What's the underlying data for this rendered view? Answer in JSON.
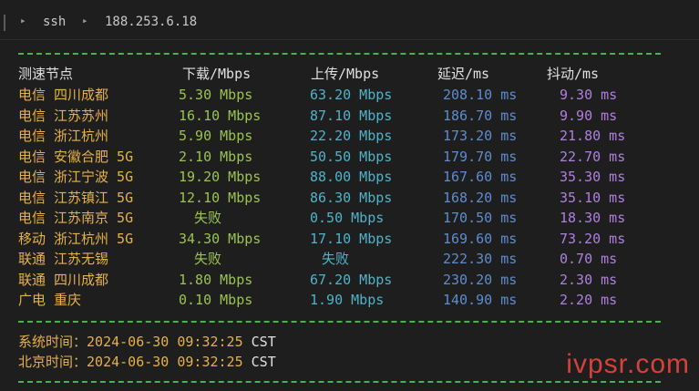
{
  "titlebar": {
    "crumb1": "ssh",
    "crumb2": "188.253.6.18"
  },
  "header": {
    "node": "测速节点",
    "download": "下载/Mbps",
    "upload": "上传/Mbps",
    "latency": "延迟/ms",
    "jitter": "抖动/ms"
  },
  "rows": [
    {
      "node": "电信 四川成都",
      "download": "5.30 Mbps",
      "upload": "63.20 Mbps",
      "latency": "208.10 ms",
      "jitter": "9.30 ms"
    },
    {
      "node": "电信 江苏苏州",
      "download": "16.10 Mbps",
      "upload": "87.10 Mbps",
      "latency": "186.70 ms",
      "jitter": "9.90 ms"
    },
    {
      "node": "电信 浙江杭州",
      "download": "5.90 Mbps",
      "upload": "22.20 Mbps",
      "latency": "173.20 ms",
      "jitter": "21.80 ms"
    },
    {
      "node": "电信 安徽合肥 5G",
      "download": "2.10 Mbps",
      "upload": "50.50 Mbps",
      "latency": "179.70 ms",
      "jitter": "22.70 ms"
    },
    {
      "node": "电信 浙江宁波 5G",
      "download": "19.20 Mbps",
      "upload": "88.00 Mbps",
      "latency": "167.60 ms",
      "jitter": "35.30 ms"
    },
    {
      "node": "电信 江苏镇江 5G",
      "download": "12.10 Mbps",
      "upload": "86.30 Mbps",
      "latency": "168.20 ms",
      "jitter": "35.10 ms"
    },
    {
      "node": "电信 江苏南京 5G",
      "download": "失败",
      "upload": "0.50 Mbps",
      "latency": "170.50 ms",
      "jitter": "18.30 ms"
    },
    {
      "node": "移动 浙江杭州 5G",
      "download": "34.30 Mbps",
      "upload": "17.10 Mbps",
      "latency": "169.60 ms",
      "jitter": "73.20 ms"
    },
    {
      "node": "联通 江苏无锡",
      "download": "失败",
      "upload": "失败",
      "latency": "222.30 ms",
      "jitter": "0.70 ms"
    },
    {
      "node": "联通 四川成都",
      "download": "1.80 Mbps",
      "upload": "67.20 Mbps",
      "latency": "230.20 ms",
      "jitter": "2.30 ms"
    },
    {
      "node": "广电 重庆",
      "download": "0.10 Mbps",
      "upload": "1.90 Mbps",
      "latency": "140.90 ms",
      "jitter": "2.20 ms"
    }
  ],
  "footer": {
    "system_label": "系统时间：",
    "system_value": "2024-06-30 09:32:25",
    "system_tz": "CST",
    "beijing_label": "北京时间：",
    "beijing_value": "2024-06-30 09:32:25",
    "beijing_tz": "CST"
  },
  "watermark": "ivpsr.com",
  "colors": {
    "background": "#1e1e1e",
    "dash": "#4caf50",
    "node": "#e5b14a",
    "download": "#9bc34f",
    "upload": "#4fb3c9",
    "latency": "#5e8ccf",
    "jitter": "#b07fe0",
    "watermark": "#e8463c"
  }
}
